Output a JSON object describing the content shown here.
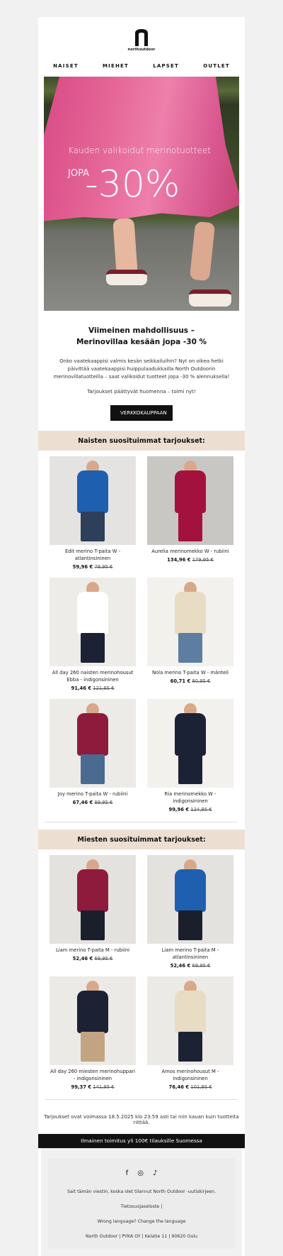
{
  "brand": {
    "logo_text": "northoutdoor"
  },
  "nav": [
    "NAISET",
    "MIEHET",
    "LAPSET",
    "OUTLET"
  ],
  "hero": {
    "subtitle": "Kauden valikoidut merinotuotteet",
    "prefix": "JOPA",
    "discount": "-30%"
  },
  "intro": {
    "heading_line1": "Viimeinen mahdollisuus –",
    "heading_line2": "Merinovillaa kesään jopa -30 %",
    "body": "Onko vaatekaappisi valmis kesän seikkailuihin? Nyt on oikea hetki päivittää vaatekaappisi huippulaadukkailla North Outdoorin merinovillatuotteilla – saat valikoidut tuotteet jopa -30 % alennuksella!",
    "ending": "Tarjoukset päättyvät huomenna – toimi nyt!",
    "cta": "VERKKOKAUPPAAN"
  },
  "women": {
    "title": "Naisten suosituimmat tarjoukset:",
    "products": [
      {
        "name": "Edit merino T-paita W - atlantinsininen",
        "price": "59,96 €",
        "old": "79,95 €",
        "top": "#1f5fb0",
        "bottom": "#2e3f5a",
        "bg": "#e4e3e1"
      },
      {
        "name": "Aurelia merinomekko W - rubiini",
        "price": "134,96 €",
        "old": "179,95 €",
        "top": "#a3123e",
        "bottom": "#a3123e",
        "bg": "#c9c7c4"
      },
      {
        "name": "All day 260 naisten merinohousut Ebba - indigonsininen",
        "price": "91,46 €",
        "old": "121,95 €",
        "top": "#ffffff",
        "bottom": "#1c2233",
        "bg": "#eeece9"
      },
      {
        "name": "Nola merino T-paita W - mänteli",
        "price": "60,71 €",
        "old": "80,95 €",
        "top": "#e9dcc4",
        "bottom": "#5d7ea0",
        "bg": "#f2f1ee"
      },
      {
        "name": "Joy merino T-paita W - rubiini",
        "price": "67,46 €",
        "old": "89,95 €",
        "top": "#8e1b3c",
        "bottom": "#4b6a90",
        "bg": "#ecebe7"
      },
      {
        "name": "Ria merinomekko W - indigonsininen",
        "price": "99,96 €",
        "old": "124,95 €",
        "top": "#1c2236",
        "bottom": "#1c2236",
        "bg": "#f2f1ee"
      }
    ]
  },
  "men": {
    "title": "Miesten suosituimmat tarjoukset:",
    "products": [
      {
        "name": "Liam merino T-paita M - rubiini",
        "price": "52,46 €",
        "old": "69,95 €",
        "top": "#8e1b3c",
        "bottom": "#1b1f2b",
        "bg": "#e4e2de"
      },
      {
        "name": "Liam merino T-paita M - atlantinsininen",
        "price": "52,46 €",
        "old": "69,95 €",
        "top": "#1f5fb0",
        "bottom": "#1b1f2b",
        "bg": "#e4e2de"
      },
      {
        "name": "All day 260 miesten merinohuppari - indigonsininen",
        "price": "99,37 €",
        "old": "141,95 €",
        "top": "#1c2233",
        "bottom": "#c3a482",
        "bg": "#eceae6"
      },
      {
        "name": "Amos merinohousut M - indigonsininen",
        "price": "76,46 €",
        "old": "101,95 €",
        "top": "#e9dcc4",
        "bottom": "#1c2233",
        "bg": "#eceae6"
      }
    ]
  },
  "validity": "Tarjoukset ovat voimassa 18.5.2025 klo 23:59 asti tai niin kauan kuin tuotteita riittää.",
  "shipping": "Ilmainen toimitus yli 100€ tilauksille Suomessa",
  "footer": {
    "social": [
      "facebook-icon",
      "instagram-icon",
      "tiktok-icon"
    ],
    "reason": "Sait tämän viestin, koska olet tilannut North Outdoor -uutiskirjeen.",
    "privacy": "Tietosuojaseloste |",
    "language": "Wrong language? Change the language",
    "address": "North Outdoor | PYKA OY | Kelatie 11 | 90620 Oulu"
  }
}
